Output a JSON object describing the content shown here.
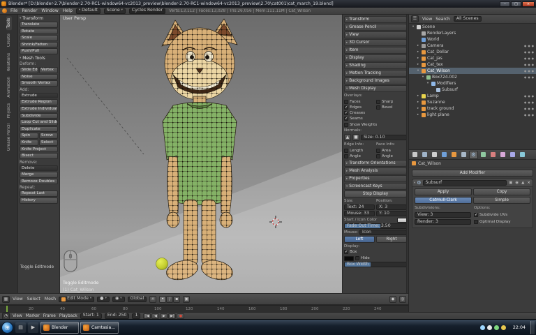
{
  "titlebar": {
    "title": "Blender* [D:\\blender-2.7\\blender-2.70-RC1-window64-vc2013_preview\\blender-2.70-RC1-window64-vc2013_preview\\2.70\\cat001\\cat_march_19.blend]",
    "buttons": {
      "minimize": "–",
      "maximize": "□",
      "close": "×"
    }
  },
  "infobar": {
    "menus": [
      "File",
      "Render",
      "Window",
      "Help"
    ],
    "layout": "Default",
    "scene": "Scene",
    "engine": "Cycles Render",
    "stats": "Verts:13,112 | Faces:13,028 | Tris:26,056 | Mem:111.11M | Cat_Wilson"
  },
  "toolshelf": {
    "tabs": [
      "Tools",
      "Create",
      "Relations",
      "Animation",
      "Physics",
      "Grease Pencil"
    ],
    "rows": [
      {
        "type": "phdr",
        "label": "Transform"
      },
      {
        "type": "btn",
        "label": "Translate"
      },
      {
        "type": "btn",
        "label": "Rotate"
      },
      {
        "type": "btn",
        "label": "Scale"
      },
      {
        "type": "btn",
        "label": "Shrink/Fatten"
      },
      {
        "type": "btn",
        "label": "Push/Pull"
      },
      {
        "type": "phdr",
        "label": "Mesh Tools"
      },
      {
        "type": "lbl",
        "label": "Deform:"
      },
      {
        "type": "split",
        "labels": [
          "Slide Edge",
          "Vertex"
        ]
      },
      {
        "type": "btn",
        "label": "Noise"
      },
      {
        "type": "btn",
        "label": "Smooth Vertex"
      },
      {
        "type": "lbl",
        "label": "Add:"
      },
      {
        "type": "btn",
        "label": "Extrude",
        "dark": true
      },
      {
        "type": "btn",
        "label": "Extrude Region"
      },
      {
        "type": "btn",
        "label": "Extrude Individual"
      },
      {
        "type": "btn",
        "label": "Subdivide"
      },
      {
        "type": "btn",
        "label": "Loop Cut and Slide"
      },
      {
        "type": "btn",
        "label": "Duplicate"
      },
      {
        "type": "split",
        "labels": [
          "Spin",
          "Screw"
        ]
      },
      {
        "type": "split",
        "labels": [
          "Knife",
          "Select"
        ]
      },
      {
        "type": "btn",
        "label": "Knife Project"
      },
      {
        "type": "btn",
        "label": "Bisect"
      },
      {
        "type": "lbl",
        "label": "Remove:"
      },
      {
        "type": "btn",
        "label": "Delete",
        "dark": true
      },
      {
        "type": "btn",
        "label": "Merge"
      },
      {
        "type": "btn",
        "label": "Remove Doubles"
      },
      {
        "type": "lbl",
        "label": "Repeat:"
      },
      {
        "type": "btn",
        "label": "Repeat Last"
      },
      {
        "type": "btn",
        "label": "History"
      }
    ],
    "redo_panel": "Toggle Editmode"
  },
  "viewport": {
    "view_label": "User Persp",
    "object_label": "(1) Cat_Wilson",
    "screencast_label": "Toggle Editmode",
    "header": {
      "menus": [
        "View",
        "Select",
        "Mesh"
      ],
      "mode": "Edit Mode",
      "orientation": "Global"
    }
  },
  "npanel": {
    "collapsed_top": [
      "Transform",
      "Grease Pencil",
      "View",
      "3D Cursor",
      "Item",
      "Display",
      "Shading",
      "Motion Tracking",
      "Background Images"
    ],
    "mesh_display": {
      "title": "Mesh Display",
      "overlays_label": "Overlays:",
      "checks_left": [
        {
          "label": "Faces",
          "checked": false
        },
        {
          "label": "Edges",
          "checked": true
        },
        {
          "label": "Creases",
          "checked": true
        },
        {
          "label": "Seams",
          "checked": true
        }
      ],
      "checks_right": [
        {
          "label": "Sharp",
          "checked": false
        },
        {
          "label": "Bevel",
          "checked": false
        }
      ],
      "show_weights": {
        "label": "Show Weights",
        "checked": false
      },
      "normals_label": "Normals:",
      "normals_size_label": "Size: 0.10",
      "edge_info_label": "Edge Info:",
      "face_info_label": "Face Info:",
      "edge_checks": [
        {
          "label": "Length",
          "checked": false
        },
        {
          "label": "Angle",
          "checked": false
        }
      ],
      "face_checks": [
        {
          "label": "Area",
          "checked": false
        },
        {
          "label": "Angle",
          "checked": false
        }
      ]
    },
    "collapsed_mid": [
      "Transform Orientations",
      "Mesh Analysis",
      "Properties"
    ],
    "screencast": {
      "title": "Screencast Keys",
      "stop_button": "Stop Display",
      "size_label": "Size:",
      "position_label": "Position:",
      "text_field": "Text: 24",
      "mouse_field": "Mouse: 33",
      "x_field": "X: 3",
      "y_field": "Y: 10",
      "color_label": "Start / Icon Color",
      "fade_field": "Fade Out Time: 3.50",
      "mouse_label": "Mouse:",
      "mouse_dropdown": "Icon",
      "left_btn": "Left",
      "right_btn": "Right",
      "display_label": "Display:",
      "box_check": {
        "label": "Box",
        "checked": true
      },
      "hide_check": {
        "label": "Hide",
        "checked": false
      },
      "box_width_label": "Box Width"
    }
  },
  "outliner": {
    "header": {
      "menus": [
        "View",
        "Search"
      ],
      "display": "All Scenes"
    },
    "rows": [
      {
        "depth": 0,
        "arrow": "▾",
        "icon": "scene",
        "label": "Scene",
        "selected": false,
        "ticons": false
      },
      {
        "depth": 1,
        "arrow": "",
        "icon": "renderlayer",
        "label": "RenderLayers",
        "ticons": false
      },
      {
        "depth": 1,
        "arrow": "",
        "icon": "world",
        "label": "World",
        "ticons": false
      },
      {
        "depth": 1,
        "arrow": "▸",
        "icon": "camera",
        "label": "Camera",
        "ticons": true
      },
      {
        "depth": 1,
        "arrow": "▸",
        "icon": "object",
        "label": "Cat_Dollar",
        "ticons": true
      },
      {
        "depth": 1,
        "arrow": "▸",
        "icon": "object",
        "label": "Cat_jas",
        "ticons": true
      },
      {
        "depth": 1,
        "arrow": "▸",
        "icon": "object",
        "label": "Cat_tex",
        "ticons": true
      },
      {
        "depth": 1,
        "arrow": "▾",
        "icon": "object",
        "label": "Cat_Wilson",
        "selected": true,
        "ticons": true
      },
      {
        "depth": 2,
        "arrow": "▾",
        "icon": "mesh",
        "label": "Box724.002",
        "ticons": true
      },
      {
        "depth": 3,
        "arrow": "▾",
        "icon": "modifier",
        "label": "Modifiers",
        "ticons": false
      },
      {
        "depth": 4,
        "arrow": "",
        "icon": "subsurf",
        "label": "Subsurf",
        "ticons": false
      },
      {
        "depth": 1,
        "arrow": "▸",
        "icon": "lamp",
        "label": "Lamp",
        "ticons": true
      },
      {
        "depth": 1,
        "arrow": "▸",
        "icon": "object",
        "label": "Suzanne",
        "ticons": true
      },
      {
        "depth": 1,
        "arrow": "▸",
        "icon": "object",
        "label": "track ground",
        "ticons": true
      },
      {
        "depth": 1,
        "arrow": "▸",
        "icon": "object",
        "label": "light plane",
        "ticons": true
      }
    ]
  },
  "properties": {
    "tabs": [
      "Render",
      "Render Layers",
      "Scene",
      "World",
      "Object",
      "Constraints",
      "Modifiers",
      "Object Data",
      "Material",
      "Texture",
      "Particles",
      "Physics"
    ],
    "active_tab": "Modifiers",
    "breadcrumb": "Cat_Wilson",
    "add_modifier": "Add Modifier",
    "modifier": {
      "name": "Subsurf",
      "apply": "Apply",
      "copy": "Copy",
      "algo_active": "Catmull-Clark",
      "algo_inactive": "Simple",
      "subdivisions_label": "Subdivisions:",
      "view_field": "View: 3",
      "render_field": "Render: 3",
      "options_label": "Options:",
      "subdivide_uvs": {
        "label": "Subdivide UVs",
        "checked": true
      },
      "optimal_display": {
        "label": "Optimal Display",
        "checked": false
      }
    }
  },
  "timeline": {
    "menus": [
      "View",
      "Marker",
      "Frame",
      "Playback"
    ],
    "start_field": "Start: 1",
    "end_field": "End: 250",
    "current_frame": "1",
    "ruler_labels": [
      "20",
      "40",
      "60",
      "80",
      "100",
      "120",
      "140",
      "160",
      "180",
      "200",
      "220",
      "240"
    ],
    "transport": [
      "|◀",
      "◀",
      "▶",
      "▶|"
    ],
    "record": "●"
  },
  "taskbar": {
    "buttons": [
      "Blender",
      "Camtasia..."
    ],
    "clock": "22:04"
  }
}
